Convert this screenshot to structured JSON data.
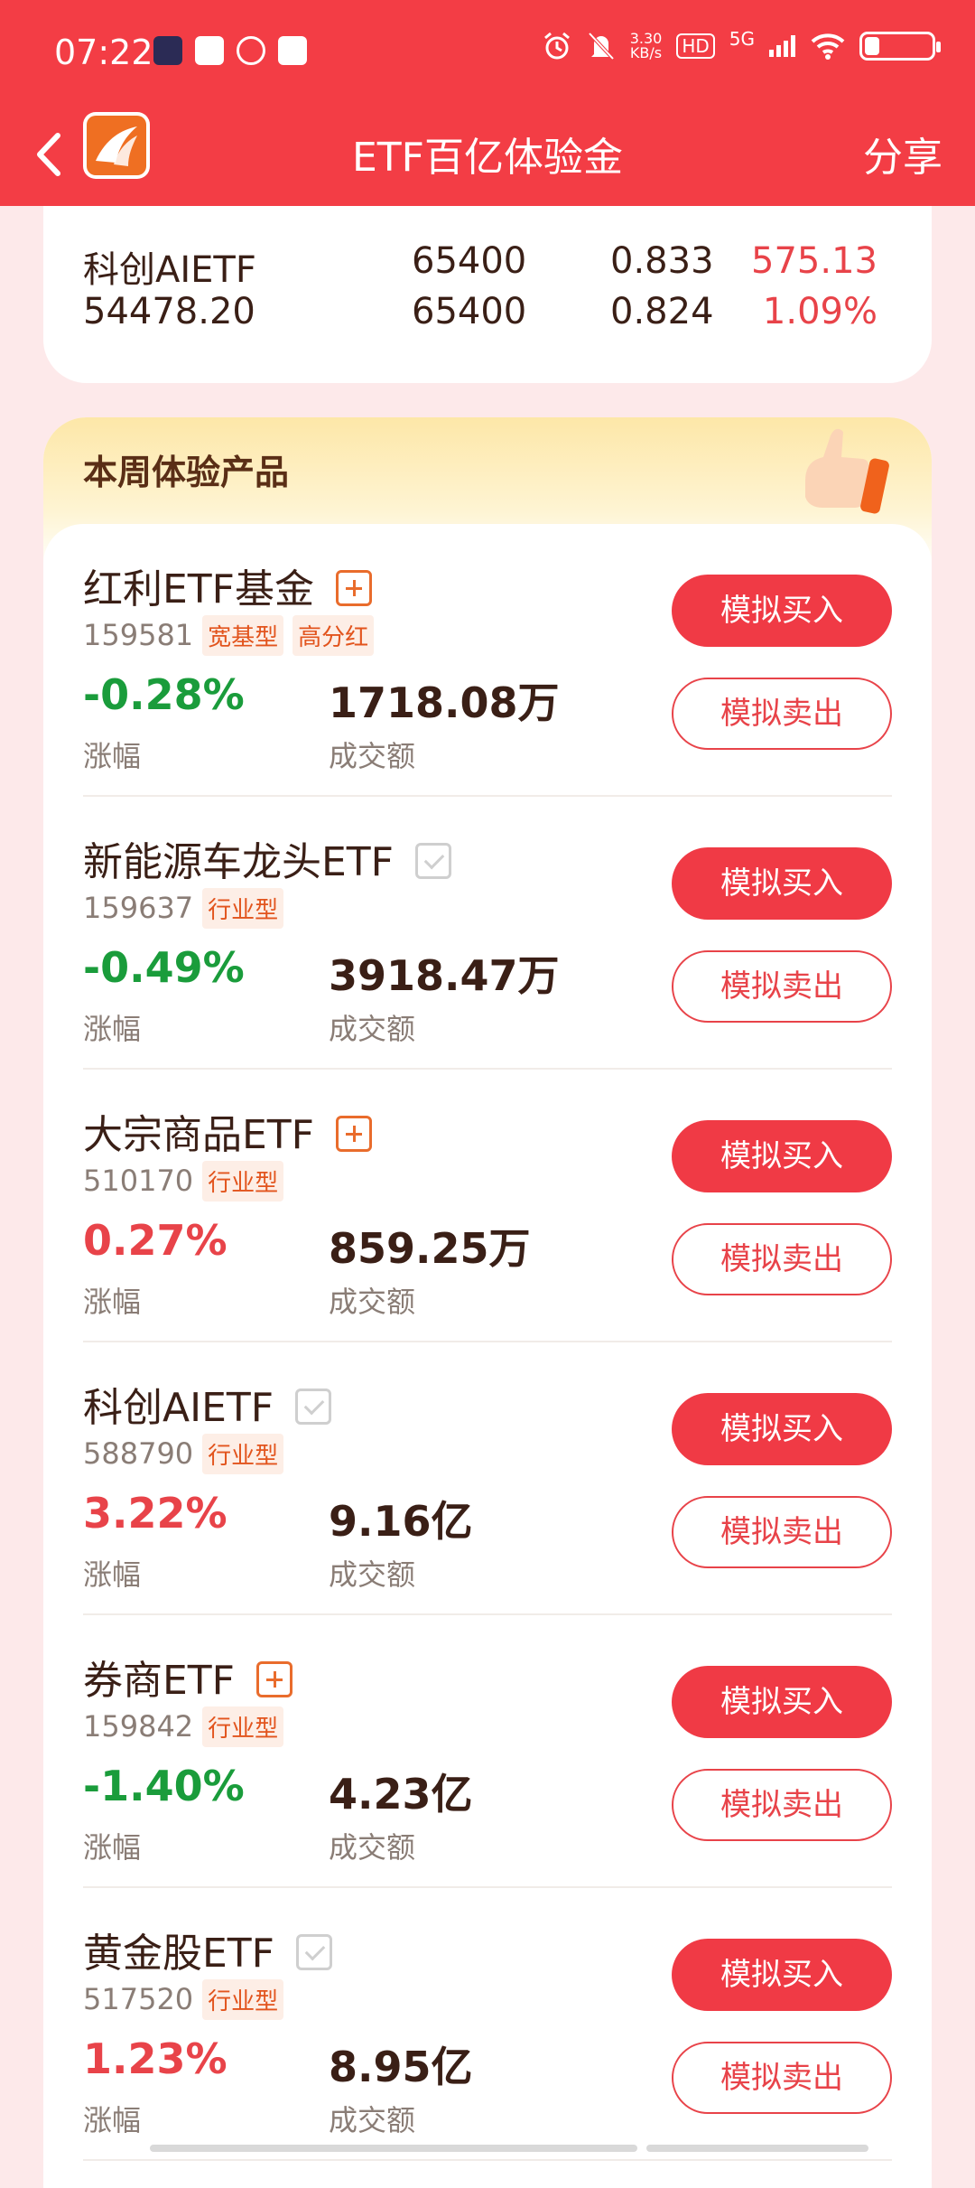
{
  "status_bar": {
    "time": "07:22",
    "speed_value": "3.30",
    "speed_unit": "KB/s",
    "hd": "HD",
    "network": "5G",
    "battery_level": 0.2
  },
  "nav": {
    "title": "ETF百亿体验金",
    "share_label": "分享"
  },
  "summary": {
    "row1": [
      "科创AIETF",
      "65400",
      "0.833",
      "575.13"
    ],
    "row2": [
      "54478.20",
      "65400",
      "0.824",
      "1.09%"
    ]
  },
  "section": {
    "title": "本周体验产品"
  },
  "labels": {
    "change": "涨幅",
    "volume": "成交额",
    "buy": "模拟买入",
    "sell": "模拟卖出"
  },
  "products": [
    {
      "name": "红利ETF基金",
      "code": "159581",
      "tags": [
        "宽基型",
        "高分红"
      ],
      "change": "-0.28%",
      "volume": "1718.08万",
      "added": false
    },
    {
      "name": "新能源车龙头ETF",
      "code": "159637",
      "tags": [
        "行业型"
      ],
      "change": "-0.49%",
      "volume": "3918.47万",
      "added": true
    },
    {
      "name": "大宗商品ETF",
      "code": "510170",
      "tags": [
        "行业型"
      ],
      "change": "0.27%",
      "volume": "859.25万",
      "added": false
    },
    {
      "name": "科创AIETF",
      "code": "588790",
      "tags": [
        "行业型"
      ],
      "change": "3.22%",
      "volume": "9.16亿",
      "added": true
    },
    {
      "name": "券商ETF",
      "code": "159842",
      "tags": [
        "行业型"
      ],
      "change": "-1.40%",
      "volume": "4.23亿",
      "added": false
    },
    {
      "name": "黄金股ETF",
      "code": "517520",
      "tags": [
        "行业型"
      ],
      "change": "1.23%",
      "volume": "8.95亿",
      "added": true
    }
  ],
  "colors": {
    "brand_red": "#f33d45",
    "up_red": "#e84349",
    "down_green": "#1a9c3b",
    "tag_orange": "#e2541d"
  }
}
